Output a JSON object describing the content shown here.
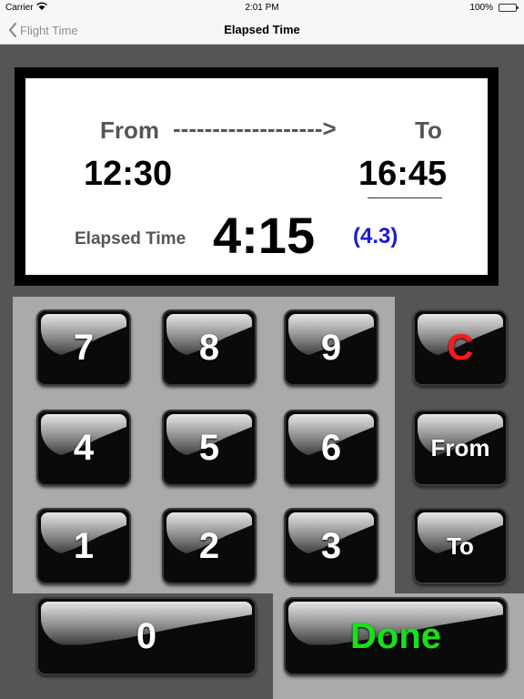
{
  "status_bar": {
    "carrier": "Carrier",
    "time": "2:01 PM",
    "battery": "100%"
  },
  "nav": {
    "back_label": "Flight Time",
    "title": "Elapsed Time"
  },
  "display": {
    "from_label": "From",
    "arrow": "------------------->",
    "to_label": "To",
    "from_value": "12:30",
    "to_value": "16:45",
    "elapsed_label": "Elapsed Time",
    "elapsed_value": "4:15",
    "elapsed_decimal": "(4.3)"
  },
  "keypad": {
    "k7": "7",
    "k8": "8",
    "k9": "9",
    "k4": "4",
    "k5": "5",
    "k6": "6",
    "k1": "1",
    "k2": "2",
    "k3": "3",
    "k0": "0",
    "clear": "C",
    "from": "From",
    "to": "To",
    "done": "Done"
  },
  "colors": {
    "clear_text": "#ff1a1a",
    "done_text": "#19e019",
    "decimal_text": "#1a1ad9"
  }
}
